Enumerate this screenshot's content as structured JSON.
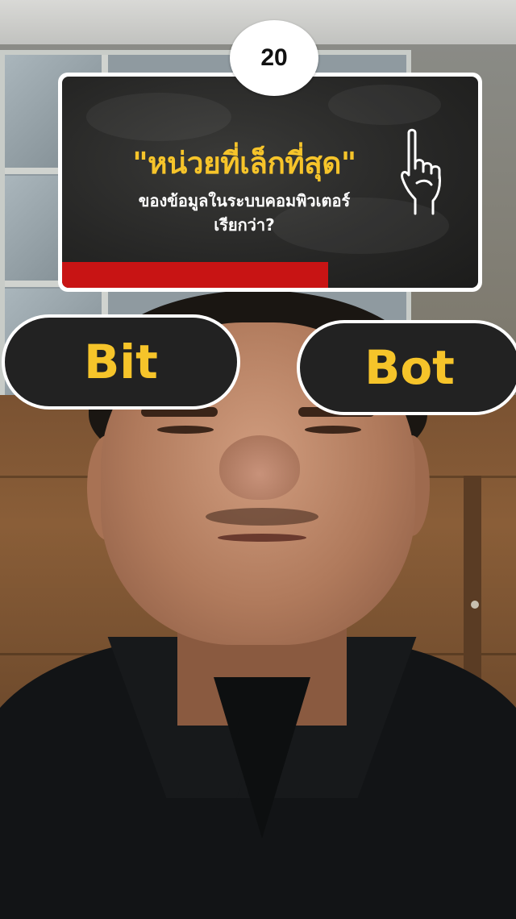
{
  "quiz": {
    "timer": "20",
    "question_main": "\"หน่วยที่เล็กที่สุด\"",
    "question_line2": "ของข้อมูลในระบบคอมพิวเตอร์",
    "question_line3": "เรียกว่า?",
    "time_remaining_fraction": 0.64,
    "icon": "pointing-hand-icon",
    "colors": {
      "accent": "#f6c42a",
      "progress": "#c81414",
      "board": "#262625",
      "answer_bg": "#222222"
    },
    "answers": [
      {
        "label": "Bit"
      },
      {
        "label": "Bot"
      }
    ]
  }
}
